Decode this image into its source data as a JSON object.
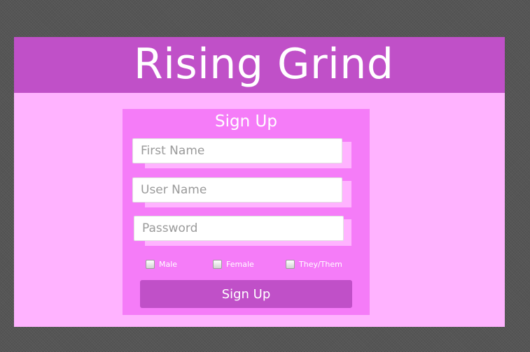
{
  "app": {
    "title": "Rising Grind"
  },
  "form": {
    "heading": "Sign Up",
    "fields": {
      "first_name": {
        "placeholder": "First Name",
        "value": ""
      },
      "user_name": {
        "placeholder": "User Name",
        "value": ""
      },
      "password": {
        "placeholder": "Password",
        "value": ""
      }
    },
    "gender_options": [
      {
        "label": "Male",
        "checked": false
      },
      {
        "label": "Female",
        "checked": false
      },
      {
        "label": "They/Them",
        "checked": false
      }
    ],
    "submit_label": "Sign Up"
  },
  "colors": {
    "page_background": "#555555",
    "header": "#C050C8",
    "app_background": "#FFB3FF",
    "card": "#F57CF8",
    "button": "#C050C8",
    "text_light": "#FFFFFF"
  }
}
